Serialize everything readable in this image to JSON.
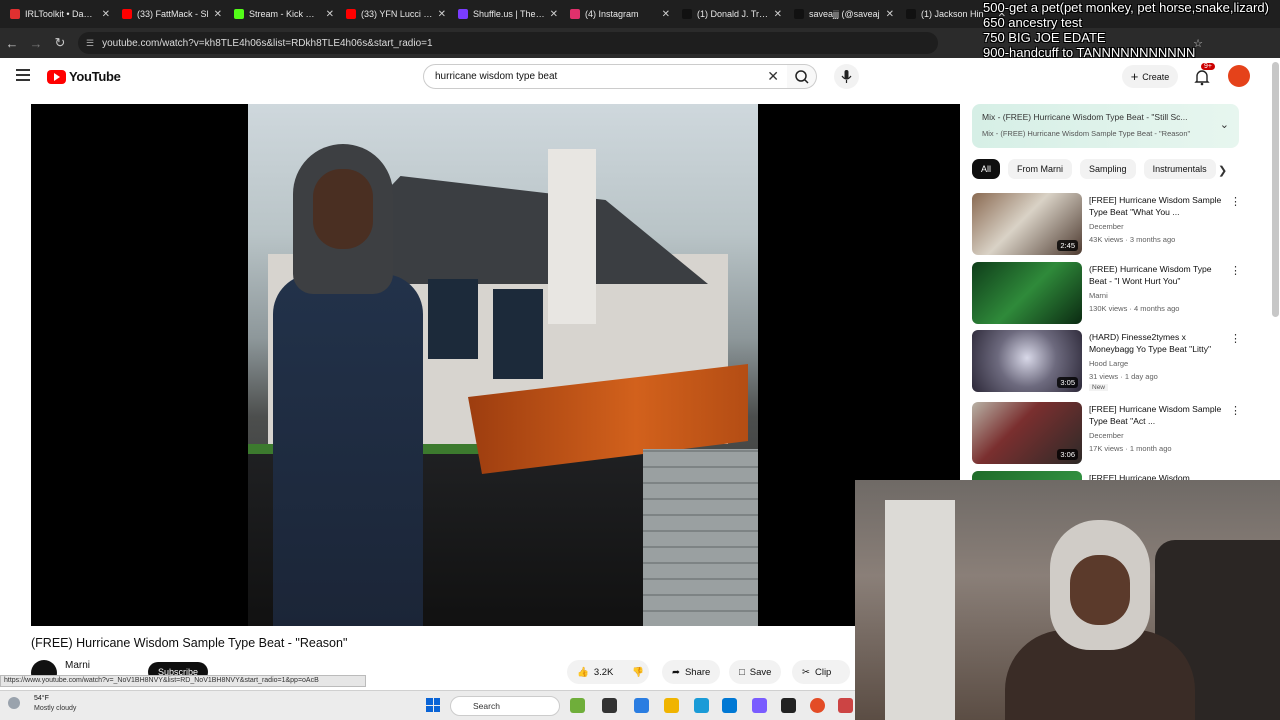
{
  "browser": {
    "tabs": [
      {
        "label": "IRLToolkit • Dashb",
        "color": "#e03030"
      },
      {
        "label": "(33) FattMack - Sl",
        "color": "#ff0000"
      },
      {
        "label": "Stream - Kick Dash",
        "color": "#53fc18"
      },
      {
        "label": "(33) YFN Lucci - O",
        "color": "#ff0000"
      },
      {
        "label": "Shuffle.us | The #1",
        "color": "#7a3cff"
      },
      {
        "label": "(4) Instagram",
        "color": "#e1306c"
      },
      {
        "label": "(1) Donald J. Trum",
        "color": "#111111"
      },
      {
        "label": "saveajjj (@saveaj",
        "color": "#111111"
      },
      {
        "label": "(1) Jackson Hin",
        "color": "#111111"
      }
    ],
    "url": "youtube.com/watch?v=kh8TLE4h06s&list=RDkh8TLE4h06s&start_radio=1"
  },
  "overlay": {
    "lines": [
      "500-get a pet(pet monkey, pet horse,snake,lizard)",
      "650 ancestry test",
      "750 BIG JOE EDATE",
      "900-handcuff to TANNNNNNNNNNN"
    ]
  },
  "youtube": {
    "logo_text": "YouTube",
    "search_query": "hurricane wisdom type beat",
    "create_label": "Create",
    "notifications_badge": "9+"
  },
  "video": {
    "title": "(FREE) Hurricane Wisdom Sample Type Beat - \"Reason\"",
    "channel": "Marni",
    "subscribe_label": "Subscribe",
    "likes": "3.2K",
    "share_label": "Share",
    "save_label": "Save",
    "clip_label": "Clip"
  },
  "status_url": "https://www.youtube.com/watch?v=_NoV1BH8NVY&list=RD_NoV1BH8NVY&start_radio=1&pp=oAcB",
  "playlist": {
    "title": "Mix - (FREE) Hurricane Wisdom Type Beat - \"Still Sc...",
    "subtitle": "Mix - (FREE) Hurricane Wisdom Sample Type Beat - \"Reason\""
  },
  "chips": [
    "All",
    "From Marni",
    "Sampling",
    "Instrumentals"
  ],
  "recommendations": [
    {
      "title": "[FREE] Hurricane Wisdom Sample Type Beat \"What You ...",
      "channel": "December",
      "meta": "43K views · 3 months ago",
      "duration": "2:45",
      "new": "",
      "thumb": "linear-gradient(135deg,#8a6a52,#d9d2c6 45%,#4e3b31)"
    },
    {
      "title": "(FREE) Hurricane Wisdom Type Beat - \"I Wont Hurt You\"",
      "channel": "Marni",
      "meta": "130K views · 4 months ago",
      "duration": "",
      "new": "",
      "thumb": "linear-gradient(135deg,#0f3d1a,#2f8a3a 50%,#0b2a12)"
    },
    {
      "title": "(HARD) Finesse2tymes x Moneybagg Yo Type Beat \"Litty\"",
      "channel": "Hood Large",
      "meta": "31 views · 1 day ago",
      "duration": "3:05",
      "new": "New",
      "thumb": "radial-gradient(circle at 50% 45%,#d8d8e8,#6d6a7e 45%,#2c2838)"
    },
    {
      "title": "[FREE] Hurricane Wisdom Sample Type Beat \"Act ...",
      "channel": "December",
      "meta": "17K views · 1 month ago",
      "duration": "3:06",
      "new": "",
      "thumb": "linear-gradient(135deg,#b8b2a6,#7a2f2f 40%,#2d2a28)"
    },
    {
      "title": "[FREE] Hurricane Wisdom",
      "channel": "",
      "meta": "",
      "duration": "",
      "new": "",
      "thumb": "linear-gradient(135deg,#1f6b2a,#3aa04a)"
    }
  ],
  "taskbar": {
    "weather_temp": "54°F",
    "weather_desc": "Mostly cloudy",
    "search_label": "Search"
  }
}
